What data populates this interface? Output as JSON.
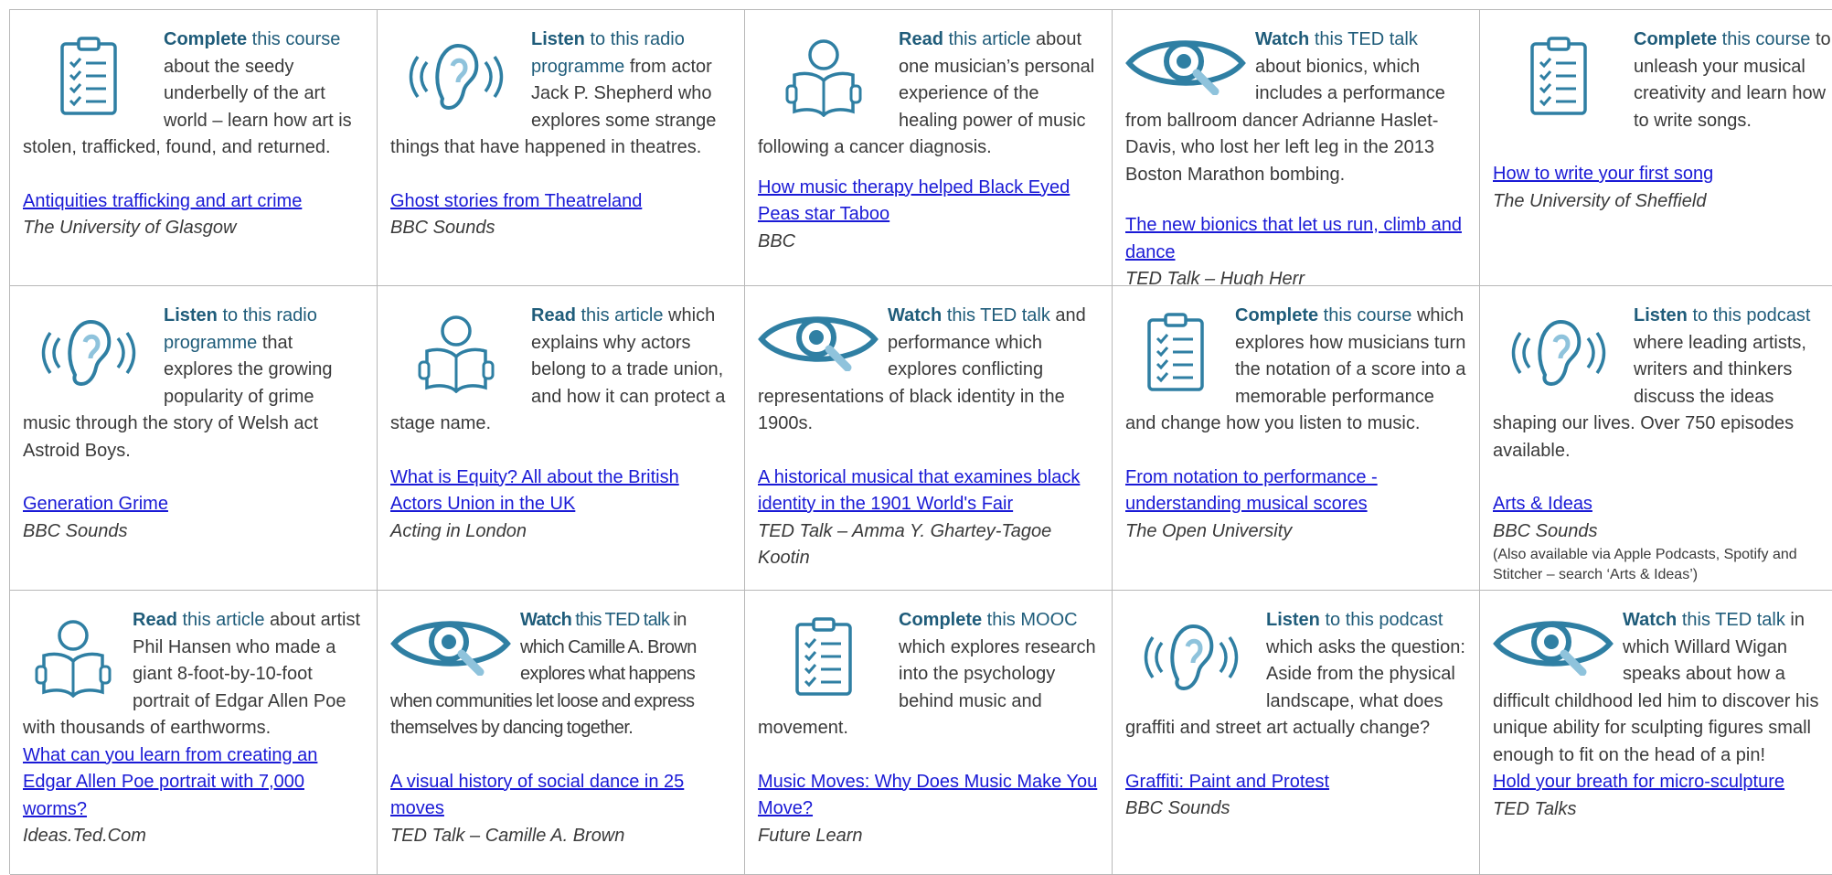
{
  "cells": [
    {
      "icon": "checklist-icon",
      "verb": "Complete",
      "rest": " this course",
      "desc": " about the seedy underbelly of the art world – learn how art is stolen, trafficked, found, and returned.",
      "link": "Antiquities trafficking and art crime",
      "source": "The University of Glasgow",
      "note": ""
    },
    {
      "icon": "ear-icon",
      "verb": "Listen",
      "rest": " to this radio programme",
      "desc": " from actor Jack P. Shepherd who explores some strange things that have happened in theatres.",
      "link": "Ghost stories from Theatreland",
      "source": "BBC Sounds",
      "note": ""
    },
    {
      "icon": "reader-icon",
      "verb": "Read",
      "rest": " this article",
      "desc": " about one musician’s personal experience of the healing power of music following a cancer diagnosis.",
      "link": "How music therapy helped Black Eyed Peas star Taboo",
      "source": "BBC",
      "note": ""
    },
    {
      "icon": "eye-icon",
      "verb": "Watch",
      "rest": " this TED talk",
      "desc": " about bionics, which includes a performance from ballroom dancer Adrianne Haslet-Davis, who lost her left leg in the 2013 Boston Marathon bombing.",
      "link": "The new bionics that let us run, climb and dance",
      "source": "TED Talk – Hugh Herr",
      "note": ""
    },
    {
      "icon": "checklist-icon",
      "verb": "Complete",
      "rest": " this course",
      "desc": " to unleash your musical creativity and learn how to write songs.",
      "link": "How to write your first song",
      "source": "The University of Sheffield",
      "note": ""
    },
    {
      "icon": "ear-icon",
      "verb": "Listen",
      "rest": " to this radio programme",
      "desc": " that explores the growing popularity of grime music through the story of Welsh act Astroid Boys.",
      "link": "Generation Grime",
      "source": "BBC Sounds",
      "note": ""
    },
    {
      "icon": "reader-icon",
      "verb": "Read",
      "rest": " this article",
      "desc": " which explains why actors belong to a trade union, and how it can protect a stage name.",
      "link": "What is Equity? All about the British Actors Union in the UK",
      "source": "Acting in London",
      "note": ""
    },
    {
      "icon": "eye-icon",
      "verb": "Watch",
      "rest": " this TED talk",
      "desc": " and performance which explores conflicting representations of black identity in the 1900s.",
      "link": "A historical musical that examines black identity in the 1901 World's Fair",
      "source": "TED Talk – Amma Y. Ghartey-Tagoe Kootin",
      "note": ""
    },
    {
      "icon": "checklist-icon",
      "verb": "Complete",
      "rest": " this course",
      "desc": " which explores how musicians turn the notation of a score into a memorable performance and change how you listen to music.",
      "link": "From notation to performance - understanding musical scores",
      "source": "The Open University",
      "note": ""
    },
    {
      "icon": "ear-icon",
      "verb": "Listen",
      "rest": " to this podcast",
      "desc": " where leading artists, writers and thinkers discuss the ideas shaping our lives. Over 750 episodes available.",
      "link": "Arts & Ideas",
      "source": "BBC Sounds",
      "note": "(Also available via Apple Podcasts, Spotify and Stitcher – search ‘Arts & Ideas’)"
    },
    {
      "icon": "reader-icon",
      "verb": "Read",
      "rest": " this article",
      "desc": " about artist Phil Hansen who made a giant 8-foot-by-10-foot portrait of Edgar Allen Poe with thousands of earthworms.",
      "link": "What can you learn from creating an Edgar Allen Poe portrait with 7,000 worms?",
      "source": "Ideas.Ted.Com",
      "note": ""
    },
    {
      "icon": "eye-icon",
      "verb": "Watch",
      "rest": " this TED talk",
      "desc": " in which Camille A. Brown explores what happens when communities let loose and express themselves by dancing together.",
      "link": "A visual history of social dance in 25 moves",
      "source": "TED Talk – Camille A. Brown",
      "note": ""
    },
    {
      "icon": "checklist-icon",
      "verb": "Complete",
      "rest": " this MOOC",
      "desc": " which explores research into the psychology behind music and movement.",
      "link": "Music Moves: Why Does Music Make You Move?",
      "source": "Future Learn",
      "note": ""
    },
    {
      "icon": "ear-icon",
      "verb": "Listen",
      "rest": " to this podcast",
      "desc": " which asks the question: Aside from the physical landscape, what does graffiti and street art actually change?",
      "link": "Graffiti: Paint and Protest",
      "source": "BBC Sounds",
      "note": ""
    },
    {
      "icon": "eye-icon",
      "verb": "Watch",
      "rest": " this TED talk",
      "desc": " in which Willard Wigan speaks about how a difficult childhood led him to discover his unique ability for sculpting figures small enough to fit on the head of a pin!",
      "link": "Hold your breath for micro-sculpture",
      "source": "TED Talks",
      "note": ""
    }
  ]
}
